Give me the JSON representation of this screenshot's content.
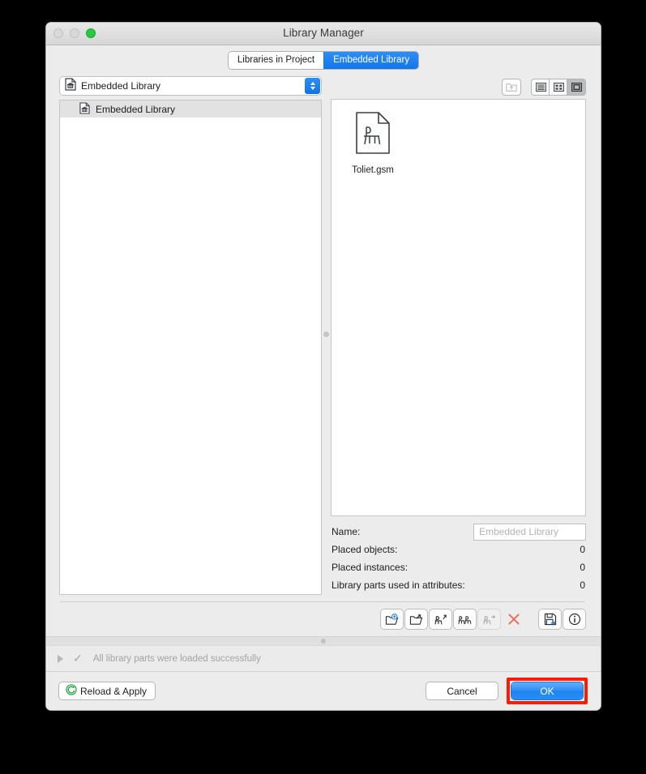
{
  "window": {
    "title": "Library Manager",
    "traffic_lights": [
      "close",
      "minimize",
      "zoom"
    ]
  },
  "tabs": [
    {
      "label": "Libraries in Project",
      "active": false
    },
    {
      "label": "Embedded Library",
      "active": true
    }
  ],
  "left_pane": {
    "popup": {
      "value": "Embedded Library",
      "icon": "library-document-icon"
    },
    "list": [
      {
        "label": "Embedded Library",
        "icon": "library-document-icon",
        "selected": true
      }
    ]
  },
  "right_pane": {
    "view_buttons": [
      {
        "name": "parent-folder-button",
        "icon": "folder-up-icon",
        "state": "disabled"
      },
      {
        "name": "list-view-button",
        "icon": "list-view-icon",
        "state": "normal"
      },
      {
        "name": "grid-view-button",
        "icon": "grid-view-icon",
        "state": "normal"
      },
      {
        "name": "icon-view-button",
        "icon": "large-icon-view-icon",
        "state": "pressed"
      }
    ],
    "files": [
      {
        "name": "Toliet.gsm",
        "icon": "gsm-part-document-icon"
      }
    ],
    "info": {
      "name_label": "Name:",
      "name_placeholder": "Embedded Library",
      "name_value": "",
      "rows": [
        {
          "label": "Placed objects:",
          "value": "0"
        },
        {
          "label": "Placed instances:",
          "value": "0"
        },
        {
          "label": "Library parts used in attributes:",
          "value": "0"
        }
      ]
    },
    "action_buttons": [
      {
        "name": "new-folder-button",
        "icon": "folder-add-icon",
        "state": "normal"
      },
      {
        "name": "export-folder-button",
        "icon": "folder-export-icon",
        "state": "normal"
      },
      {
        "name": "add-library-part-button",
        "icon": "part-add-icon",
        "state": "normal"
      },
      {
        "name": "duplicate-library-part-button",
        "icon": "parts-duplicate-icon",
        "state": "normal"
      },
      {
        "name": "move-library-part-button",
        "icon": "part-move-icon",
        "state": "disabled"
      },
      {
        "name": "delete-button",
        "icon": "close-x-icon",
        "state": "normal"
      }
    ],
    "utility_buttons": [
      {
        "name": "save-as-button",
        "icon": "floppy-export-icon",
        "state": "normal"
      },
      {
        "name": "info-button",
        "icon": "info-circle-icon",
        "state": "normal"
      }
    ]
  },
  "status": {
    "text": "All library parts were loaded successfully",
    "disclosure": "collapsed",
    "check": "✓"
  },
  "footer": {
    "reload_label": "Reload & Apply",
    "reload_icon": "refresh-circle-icon",
    "cancel_label": "Cancel",
    "ok_label": "OK",
    "ok_highlight_color": "#ff1a00"
  },
  "colors": {
    "accent_blue": "#2f8ef4",
    "window_bg": "#ececec",
    "highlight_red": "#ff1a00",
    "reload_green": "#2aa84a"
  }
}
